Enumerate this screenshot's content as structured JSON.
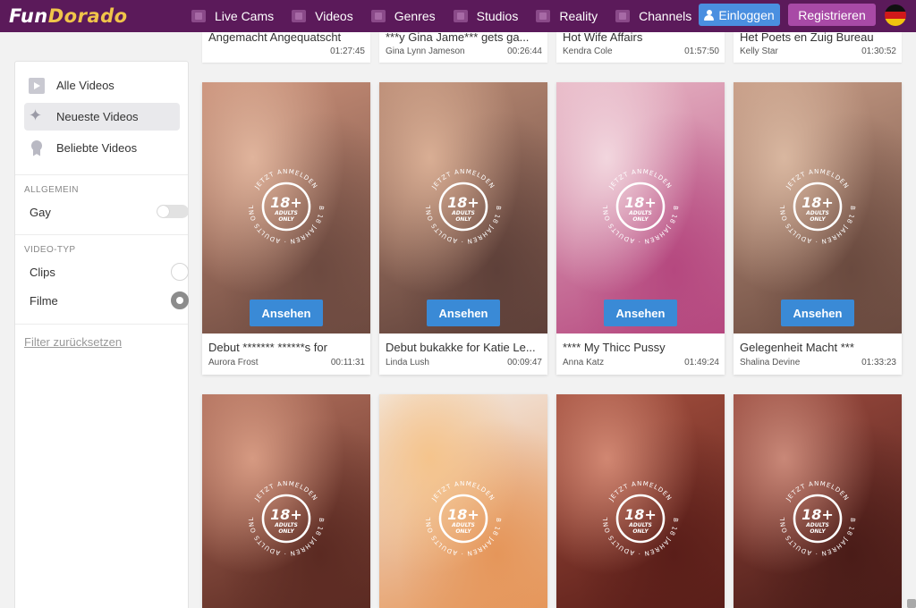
{
  "brand": {
    "part1": "Fun",
    "part2": "Dorado"
  },
  "nav": [
    {
      "label": "Live Cams",
      "icon": "webcam-icon"
    },
    {
      "label": "Videos",
      "icon": "video-icon"
    },
    {
      "label": "Genres",
      "icon": "film-icon"
    },
    {
      "label": "Studios",
      "icon": "studio-icon"
    },
    {
      "label": "Reality",
      "icon": "clapperboard-icon"
    },
    {
      "label": "Channels",
      "icon": "channel-icon"
    }
  ],
  "header": {
    "login_label": "Einloggen",
    "register_label": "Registrieren",
    "language": "DE"
  },
  "top_row": [
    {
      "title": "Angemacht Angequatscht",
      "author": "",
      "duration": "01:27:45"
    },
    {
      "title": "***y Gina Jame*** gets ga...",
      "author": "Gina Lynn Jameson",
      "duration": "00:26:44"
    },
    {
      "title": "Hot Wife Affairs",
      "author": "Kendra Cole",
      "duration": "01:57:50"
    },
    {
      "title": "Het Poets en Zuig Bureau",
      "author": "Kelly Star",
      "duration": "01:30:52"
    }
  ],
  "sidebar": {
    "items": [
      {
        "label": "Alle Videos",
        "icon": "video-play-icon",
        "active": false
      },
      {
        "label": "Neueste Videos",
        "icon": "sparkle-icon",
        "active": true
      },
      {
        "label": "Beliebte Videos",
        "icon": "medal-icon",
        "active": false
      }
    ],
    "section_general": "ALLGEMEIN",
    "gay_label": "Gay",
    "gay_enabled": false,
    "section_type": "VIDEO-TYP",
    "type_options": [
      {
        "label": "Clips",
        "selected": false
      },
      {
        "label": "Filme",
        "selected": true
      }
    ],
    "reset_label": "Filter zurücksetzen"
  },
  "badge": {
    "top_text": "JETZT ANMELDEN",
    "side_text": "AB 18 JAHREN",
    "bottom_text": "ADULTS ONLY",
    "big": "18+",
    "small1": "ADULTS",
    "small2": "ONLY"
  },
  "watch_label": "Ansehen",
  "videos": [
    {
      "title": "Debut ******* ******s for",
      "author": "Aurora Frost",
      "duration": "00:11:31",
      "colors": [
        "#c98f78",
        "#6d4a40",
        "#e0b49c"
      ]
    },
    {
      "title": "Debut bukakke for Katie Le...",
      "author": "Linda Lush",
      "duration": "00:09:47",
      "colors": [
        "#b98a74",
        "#5e4039",
        "#d9ae94"
      ]
    },
    {
      "title": "**** My Thicc Pussy",
      "author": "Anna Katz",
      "duration": "01:49:24",
      "colors": [
        "#e7b6c4",
        "#b5487f",
        "#f2d6de"
      ]
    },
    {
      "title": "Gelegenheit Macht ***",
      "author": "Shalina Devine",
      "duration": "01:33:23",
      "colors": [
        "#c59a84",
        "#6a4a3f",
        "#d9b7a0"
      ]
    },
    {
      "colors": [
        "#b06f5c",
        "#5b2a22",
        "#d69a82"
      ]
    },
    {
      "colors": [
        "#f3ede8",
        "#e5965a",
        "#f5c48c"
      ]
    },
    {
      "colors": [
        "#a4503f",
        "#5a1e19",
        "#d18772"
      ]
    },
    {
      "colors": [
        "#9a4a3e",
        "#4a1c18",
        "#c98878"
      ]
    }
  ]
}
